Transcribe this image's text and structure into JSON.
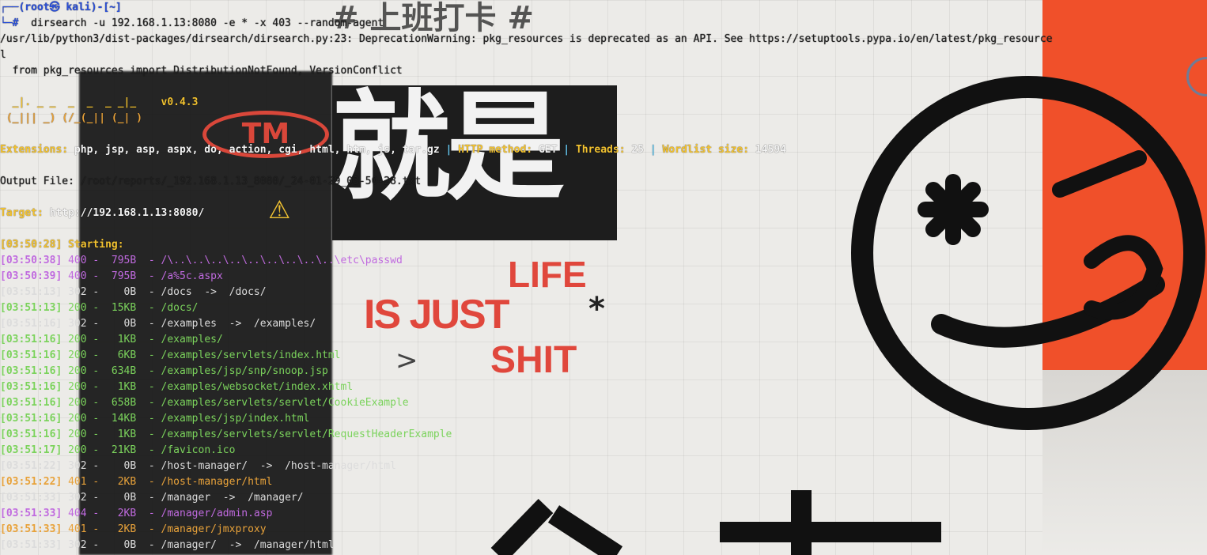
{
  "wallpaper": {
    "top_title": "# 上班打卡 #",
    "headline": "就是",
    "tm": "TM",
    "life": "LIFE",
    "is_just": "IS JUST",
    "shit": "SHIT",
    "star": "*",
    "arrow": ">",
    "colors": {
      "orange": "#f0502a",
      "card": "#1d1d1d",
      "red_text": "#e0473c"
    }
  },
  "terminal": {
    "prompt_user": "┌──(root㉿ kali)-[~]",
    "prompt_hash": "└─#",
    "command": "dirsearch -u 192.168.1.13:8080 -e * -x 403 --random-agent",
    "warning_path": "/usr/lib/python3/dist-packages/dirsearch/dirsearch.py:23: DeprecationWarning: pkg_resources is deprecated as an API. See https://setuptools.pypa.io/en/latest/pkg_resource",
    "warning_cont": "l",
    "import_line": "  from pkg_resources import DistributionNotFound, VersionConflict",
    "banner1": "  _|. _ _  _  _  _ _|_    v0.4.3",
    "banner2": " (_||| _) (/_(_|| (_| )",
    "ext_label": "Extensions:",
    "ext_values": " php, jsp, asp, aspx, do, action, cgi, html, htm, js, tar.gz ",
    "sep": "|",
    "method_label": " HTTP method:",
    "method_value": " GET ",
    "threads_label": " Threads:",
    "threads_value": " 25 ",
    "wordlist_label": " Wordlist size:",
    "wordlist_value": " 14594",
    "output_label": "Output File:",
    "output_value": " /root/reports/_192.168.1.13_8080/_24-01-29_03-50-28.txt",
    "target_label": "Target:",
    "target_value": " http://192.168.1.13:8080/",
    "starting_ts": "[03:50:28]",
    "starting_label": " Starting:",
    "results": [
      {
        "ts": "[03:50:38]",
        "status": "400",
        "size": "795B",
        "path": "/\\..\\..\\..\\..\\..\\..\\..\\..\\..\\etc\\passwd",
        "redirect": "",
        "color": "#c06adf"
      },
      {
        "ts": "[03:50:39]",
        "status": "400",
        "size": "795B",
        "path": "/a%5c.aspx",
        "redirect": "",
        "color": "#c06adf"
      },
      {
        "ts": "[03:51:13]",
        "status": "302",
        "size": "0B",
        "path": "/docs",
        "redirect": "/docs/",
        "color": "#dcdcdc"
      },
      {
        "ts": "[03:51:13]",
        "status": "200",
        "size": "15KB",
        "path": "/docs/",
        "redirect": "",
        "color": "#7bd35c"
      },
      {
        "ts": "[03:51:16]",
        "status": "302",
        "size": "0B",
        "path": "/examples",
        "redirect": "/examples/",
        "color": "#dcdcdc"
      },
      {
        "ts": "[03:51:16]",
        "status": "200",
        "size": "1KB",
        "path": "/examples/",
        "redirect": "",
        "color": "#7bd35c"
      },
      {
        "ts": "[03:51:16]",
        "status": "200",
        "size": "6KB",
        "path": "/examples/servlets/index.html",
        "redirect": "",
        "color": "#7bd35c"
      },
      {
        "ts": "[03:51:16]",
        "status": "200",
        "size": "634B",
        "path": "/examples/jsp/snp/snoop.jsp",
        "redirect": "",
        "color": "#7bd35c"
      },
      {
        "ts": "[03:51:16]",
        "status": "200",
        "size": "1KB",
        "path": "/examples/websocket/index.xhtml",
        "redirect": "",
        "color": "#7bd35c"
      },
      {
        "ts": "[03:51:16]",
        "status": "200",
        "size": "658B",
        "path": "/examples/servlets/servlet/CookieExample",
        "redirect": "",
        "color": "#7bd35c"
      },
      {
        "ts": "[03:51:16]",
        "status": "200",
        "size": "14KB",
        "path": "/examples/jsp/index.html",
        "redirect": "",
        "color": "#7bd35c"
      },
      {
        "ts": "[03:51:16]",
        "status": "200",
        "size": "1KB",
        "path": "/examples/servlets/servlet/RequestHeaderExample",
        "redirect": "",
        "color": "#7bd35c"
      },
      {
        "ts": "[03:51:17]",
        "status": "200",
        "size": "21KB",
        "path": "/favicon.ico",
        "redirect": "",
        "color": "#7bd35c"
      },
      {
        "ts": "[03:51:22]",
        "status": "302",
        "size": "0B",
        "path": "/host-manager/",
        "redirect": "/host-manager/html",
        "color": "#dcdcdc"
      },
      {
        "ts": "[03:51:22]",
        "status": "401",
        "size": "2KB",
        "path": "/host-manager/html",
        "redirect": "",
        "color": "#e8a23a"
      },
      {
        "ts": "[03:51:33]",
        "status": "302",
        "size": "0B",
        "path": "/manager",
        "redirect": "/manager/",
        "color": "#dcdcdc"
      },
      {
        "ts": "[03:51:33]",
        "status": "404",
        "size": "2KB",
        "path": "/manager/admin.asp",
        "redirect": "",
        "color": "#c06adf"
      },
      {
        "ts": "[03:51:33]",
        "status": "401",
        "size": "2KB",
        "path": "/manager/jmxproxy",
        "redirect": "",
        "color": "#e8a23a"
      },
      {
        "ts": "[03:51:33]",
        "status": "302",
        "size": "0B",
        "path": "/manager/",
        "redirect": "/manager/html",
        "color": "#dcdcdc"
      }
    ]
  }
}
